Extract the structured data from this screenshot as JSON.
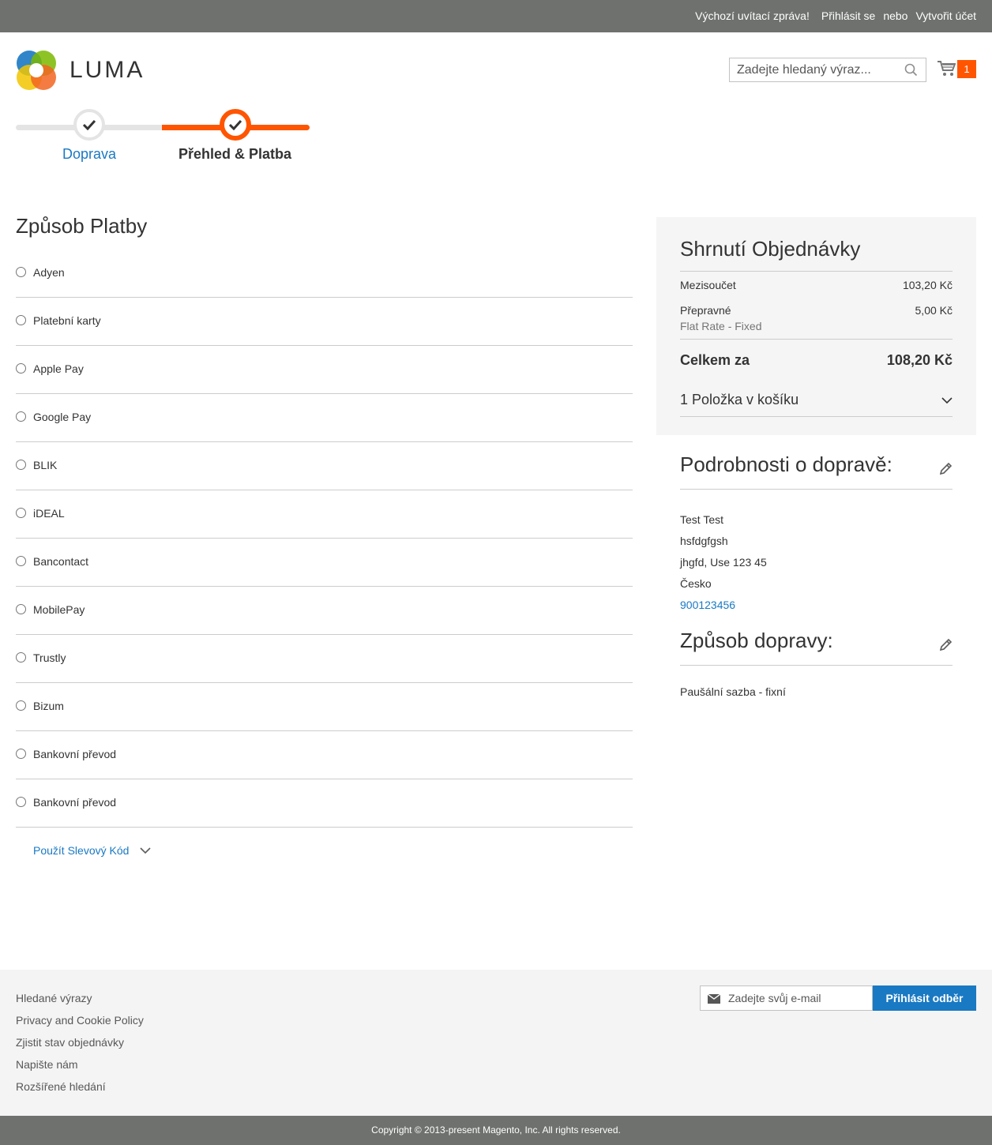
{
  "topbar": {
    "welcome": "Výchozí uvítací zpráva!",
    "sign_in": "Přihlásit se",
    "or": "nebo",
    "create_account": "Vytvořit účet"
  },
  "header": {
    "logo_text": "LUMA",
    "search_placeholder": "Zadejte hledaný výraz...",
    "cart_count": "1",
    "accent_color": "#ff5501"
  },
  "progress": {
    "steps": [
      {
        "label": "Doprava",
        "state": "complete"
      },
      {
        "label": "Přehled & Platba",
        "state": "active"
      }
    ]
  },
  "payment": {
    "title": "Způsob Platby",
    "methods": [
      {
        "label": "Adyen"
      },
      {
        "label": "Platební karty"
      },
      {
        "label": "Apple Pay"
      },
      {
        "label": "Google Pay"
      },
      {
        "label": "BLIK"
      },
      {
        "label": "iDEAL"
      },
      {
        "label": "Bancontact"
      },
      {
        "label": "MobilePay"
      },
      {
        "label": "Trustly"
      },
      {
        "label": "Bizum"
      },
      {
        "label": "Bankovní převod"
      },
      {
        "label": "Bankovní převod"
      }
    ],
    "discount_label": "Použít Slevový Kód"
  },
  "summary": {
    "title": "Shrnutí Objednávky",
    "subtotal_label": "Mezisoučet",
    "subtotal_value": "103,20 Kč",
    "shipping_label": "Přepravné",
    "shipping_value": "5,00 Kč",
    "shipping_note": "Flat Rate - Fixed",
    "total_label": "Celkem za",
    "total_value": "108,20 Kč",
    "items_label": "1 Položka v košíku"
  },
  "shipping_info": {
    "title": "Podrobnosti o dopravě:",
    "name": "Test Test",
    "street": "hsfdgfgsh",
    "city_line": "jhgfd, Use 123 45",
    "country": "Česko",
    "phone": "900123456"
  },
  "shipping_method": {
    "title": "Způsob dopravy:",
    "value": "Paušální sazba - fixní"
  },
  "footer": {
    "links": [
      "Hledané výrazy",
      "Privacy and Cookie Policy",
      "Zjistit stav objednávky",
      "Napište nám",
      "Rozšířené hledání"
    ],
    "newsletter_placeholder": "Zadejte svůj e-mail",
    "subscribe_label": "Přihlásit odběr",
    "copyright": "Copyright © 2013-present Magento, Inc. All rights reserved."
  }
}
